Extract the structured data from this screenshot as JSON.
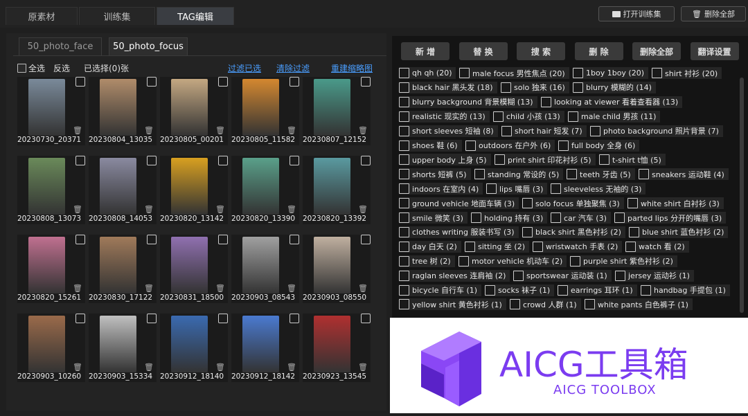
{
  "top_tabs": [
    "原素材",
    "训练集",
    "TAG编辑"
  ],
  "top_buttons": {
    "open_trainset": "打开训练集",
    "delete_all": "删除全部"
  },
  "sub_tabs": [
    "50_photo_face",
    "50_photo_focus"
  ],
  "toolbar": {
    "select_all": "全选",
    "invert": "反选",
    "selected_count": "已选择(0)张",
    "filter_selected": "过滤已选",
    "clear_filter": "清除过滤",
    "rebuild_thumbs": "重建缩略图"
  },
  "images": [
    {
      "name": "20230730_20371",
      "color": "#7a8a9a"
    },
    {
      "name": "20230804_13035",
      "color": "#b08c6a"
    },
    {
      "name": "20230805_00201",
      "color": "#c4a882"
    },
    {
      "name": "20230805_11582",
      "color": "#d48830"
    },
    {
      "name": "20230807_12152",
      "color": "#4a9a8a"
    },
    {
      "name": "20230808_13073",
      "color": "#6a8a5a"
    },
    {
      "name": "20230808_14053",
      "color": "#8a8aa0"
    },
    {
      "name": "20230820_13142",
      "color": "#d8a020"
    },
    {
      "name": "20230820_13390",
      "color": "#5aa08a"
    },
    {
      "name": "20230820_13392",
      "color": "#5a9aa0"
    },
    {
      "name": "20230820_15261",
      "color": "#c07090"
    },
    {
      "name": "20230830_17122",
      "color": "#a07a5a"
    },
    {
      "name": "20230831_18500",
      "color": "#9070b0"
    },
    {
      "name": "20230903_08543",
      "color": "#a0a0a0"
    },
    {
      "name": "20230903_08550",
      "color": "#c0b0a0"
    },
    {
      "name": "20230903_10260",
      "color": "#9a6a4a"
    },
    {
      "name": "20230903_15334",
      "color": "#c0c0c0"
    },
    {
      "name": "20230912_18140",
      "color": "#3a6ab0"
    },
    {
      "name": "20230912_18142",
      "color": "#4a7ad0"
    },
    {
      "name": "20230923_13545",
      "color": "#b03030"
    }
  ],
  "right_buttons": [
    "新 增",
    "替 换",
    "搜 索",
    "删 除",
    "删除全部",
    "翻译设置"
  ],
  "tag_rows": [
    [
      "qh qh (20)",
      "male focus 男性焦点 (20)",
      "1boy 1boy (20)",
      "shirt 衬衫 (20)"
    ],
    [
      "black hair 黑头发 (18)",
      "solo 独来 (16)",
      "blurry 模糊的 (14)"
    ],
    [
      "blurry background 背景模糊 (13)",
      "looking at viewer 看着查看器 (13)"
    ],
    [
      "realistic 现实的 (13)",
      "child 小孩 (13)",
      "male child 男孩 (11)"
    ],
    [
      "short sleeves 短袖 (8)",
      "short hair 短发 (7)",
      "photo background 照片背景 (7)"
    ],
    [
      "shoes 鞋 (6)",
      "outdoors 在户外 (6)",
      "full body 全身 (6)"
    ],
    [
      "upper body 上身 (5)",
      "print shirt 印花衬衫 (5)",
      "t-shirt t恤 (5)"
    ],
    [
      "shorts 短裤 (5)",
      "standing 常设的 (5)",
      "teeth 牙齿 (5)",
      "sneakers 运动鞋 (4)"
    ],
    [
      "indoors 在室内 (4)",
      "lips 嘴唇 (3)",
      "sleeveless 无袖的 (3)"
    ],
    [
      "ground vehicle 地面车辆 (3)",
      "solo focus 单独聚焦 (3)",
      "white shirt 白衬衫 (3)"
    ],
    [
      "smile 微笑 (3)",
      "holding 持有 (3)",
      "car 汽车 (3)",
      "parted lips 分开的嘴唇 (3)"
    ],
    [
      "clothes writing 服装书写 (3)",
      "black shirt 黑色衬衫 (2)",
      "blue shirt 蓝色衬衫 (2)"
    ],
    [
      "day 白天 (2)",
      "sitting 坐 (2)",
      "wristwatch 手表 (2)",
      "watch 看 (2)"
    ],
    [
      "tree 树 (2)",
      "motor vehicle 机动车 (2)",
      "purple shirt 紫色衬衫 (2)"
    ],
    [
      "raglan sleeves 连肩袖 (2)",
      "sportswear 运动装 (1)",
      "jersey 运动衫 (1)"
    ],
    [
      "bicycle 自行车 (1)",
      "socks 袜子 (1)",
      "earrings 耳环 (1)",
      "handbag 手提包 (1)"
    ],
    [
      "yellow shirt 黄色衬衫 (1)",
      "crowd 人群 (1)",
      "white pants 白色裤子 (1)"
    ]
  ],
  "watermark": {
    "title": "AICG工具箱",
    "subtitle": "AICG TOOLBOX"
  },
  "colors": {
    "link": "#4a9eff",
    "accent_purple": "#7b3cf0"
  }
}
